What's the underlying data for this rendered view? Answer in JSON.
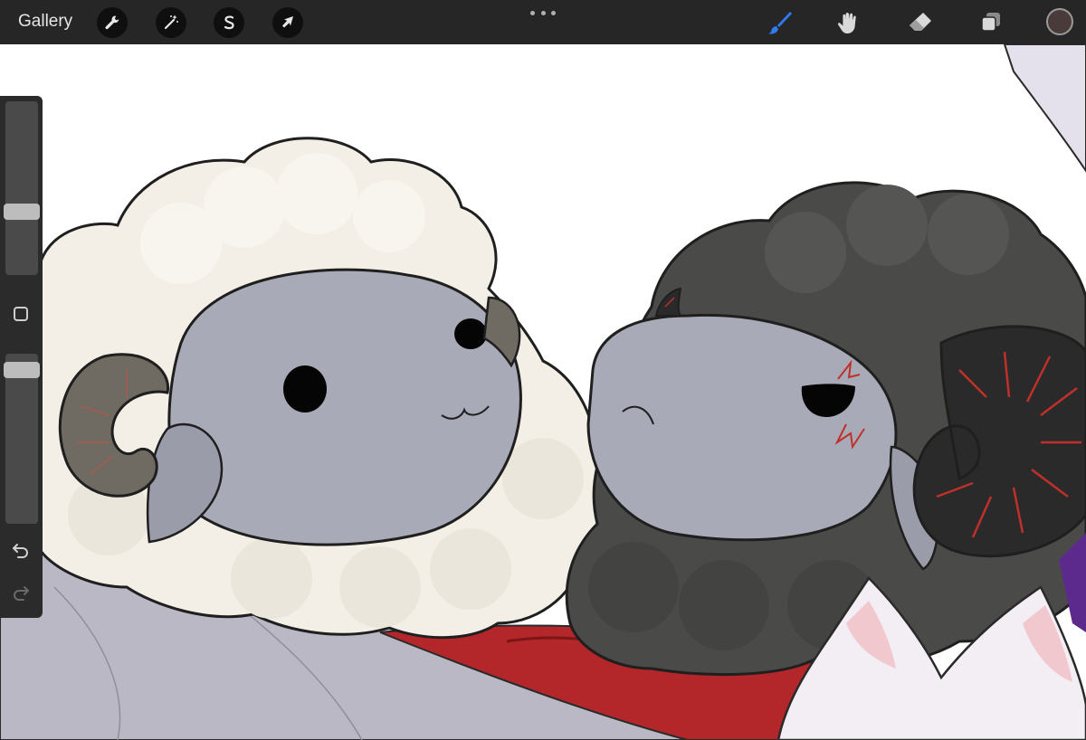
{
  "toolbar": {
    "gallery_label": "Gallery",
    "left_tools": [
      {
        "name": "actions",
        "icon": "wrench-icon"
      },
      {
        "name": "adjustments",
        "icon": "magic-wand-icon"
      },
      {
        "name": "selection",
        "icon": "selection-s-icon"
      },
      {
        "name": "transform",
        "icon": "arrow-cursor-icon"
      }
    ],
    "right_tools": [
      {
        "name": "brush",
        "icon": "brush-icon",
        "active": true
      },
      {
        "name": "smudge",
        "icon": "smudge-icon"
      },
      {
        "name": "eraser",
        "icon": "eraser-icon"
      },
      {
        "name": "layers",
        "icon": "layers-icon"
      }
    ],
    "active_color": "#4a3b3b",
    "accent_color": "#2f7bf5"
  },
  "sidebar": {
    "brush_size_level": 0.35,
    "opacity_level": 0.95,
    "modify_icon": "square-icon",
    "undo_icon": "undo-arrow-icon",
    "redo_icon": "redo-arrow-icon"
  },
  "canvas": {
    "colors": {
      "white_wool": "#f3efe6",
      "black_wool": "#4a4a48",
      "face": "#a9aab7",
      "horn_light": "#6f6a62",
      "horn_dark": "#2b2a2a",
      "horn_stripe": "#c0302a",
      "blanket": "#b9b8c4",
      "red_cloth": "#b3262a",
      "cat": "#f3eef4"
    }
  }
}
